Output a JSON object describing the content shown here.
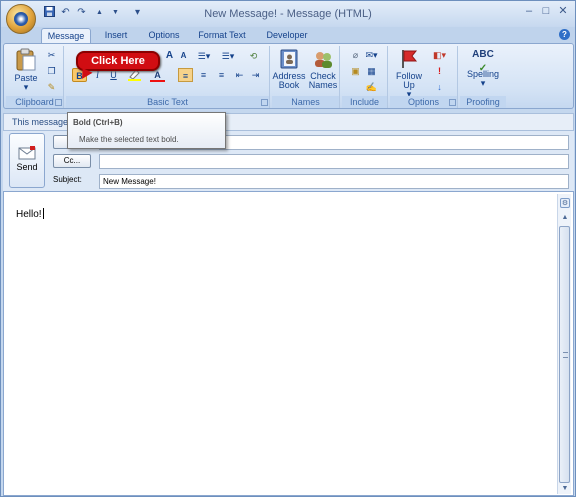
{
  "window": {
    "title": "New Message! - Message (HTML)",
    "minimize": "–",
    "maximize": "□",
    "close": "✕"
  },
  "qat": {
    "save_icon": "floppy-icon",
    "undo": "↶",
    "redo": "↷",
    "up": "▲",
    "down": "▼",
    "customize": "▾"
  },
  "tabs": [
    {
      "label": "Message",
      "active": true
    },
    {
      "label": "Insert"
    },
    {
      "label": "Options"
    },
    {
      "label": "Format Text"
    },
    {
      "label": "Developer"
    }
  ],
  "help": "?",
  "ribbon": {
    "groups": {
      "clipboard": "Clipboard",
      "basic_text": "Basic Text",
      "names": "Names",
      "include": "Include",
      "options": "Options",
      "proofing": "Proofing"
    },
    "paste_label": "Paste",
    "paste_arrow": "▾",
    "bold": "B",
    "italic": "I",
    "underline": "U",
    "font_color": "A",
    "grow_font": "A",
    "shrink_font": "A",
    "address_book": "Address Book",
    "check_names": "Check Names",
    "follow_up": "Follow Up",
    "follow_up_arrow": "▾",
    "spelling": "Spelling",
    "spelling_icon": "ABC",
    "spelling_arrow": "▾"
  },
  "callout": "Click Here",
  "message_bar": "This message",
  "tooltip": {
    "title": "Bold (Ctrl+B)",
    "description": "Make the selected text bold."
  },
  "header": {
    "send_label": "Send",
    "to_label": "T",
    "cc_label": "Cc...",
    "subject_label": "Subject:",
    "to_value": "",
    "cc_value": "",
    "subject_value": "New Message!"
  },
  "body_text": "Hello!",
  "colors": {
    "accent": "#15428b",
    "callout": "#d10d12",
    "ribbon": "#d4e3f5"
  }
}
